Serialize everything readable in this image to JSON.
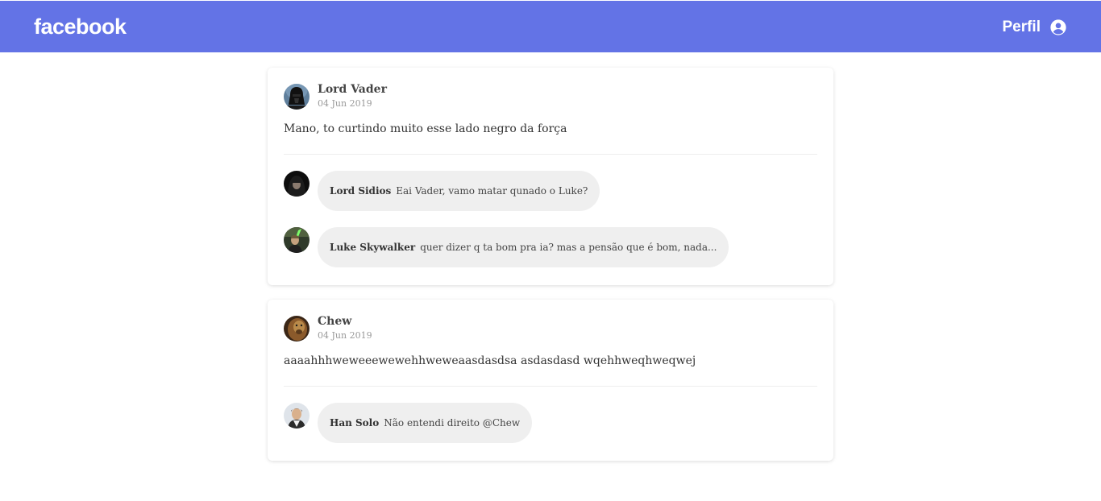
{
  "header": {
    "logo": "facebook",
    "profile_label": "Perfil",
    "profile_icon": "user-circle-icon",
    "background_color": "#6373e6"
  },
  "posts": [
    {
      "author": "Lord Vader",
      "date": "04 Jun 2019",
      "content": "Mano, to curtindo muito esse lado negro da força",
      "comments": [
        {
          "author": "Lord Sidios",
          "text": "Eai Vader, vamo matar qunado o Luke?"
        },
        {
          "author": "Luke Skywalker",
          "text": "quer dizer q ta bom pra ia? mas a pensão que é bom, nada..."
        }
      ]
    },
    {
      "author": "Chew",
      "date": "04 Jun 2019",
      "content": "aaaahhhweweeewewehhweweaasdasdsa asdasdasd wqehhweqhweqwej",
      "comments": [
        {
          "author": "Han Solo",
          "text": "Não entendi direito @Chew"
        }
      ]
    }
  ]
}
